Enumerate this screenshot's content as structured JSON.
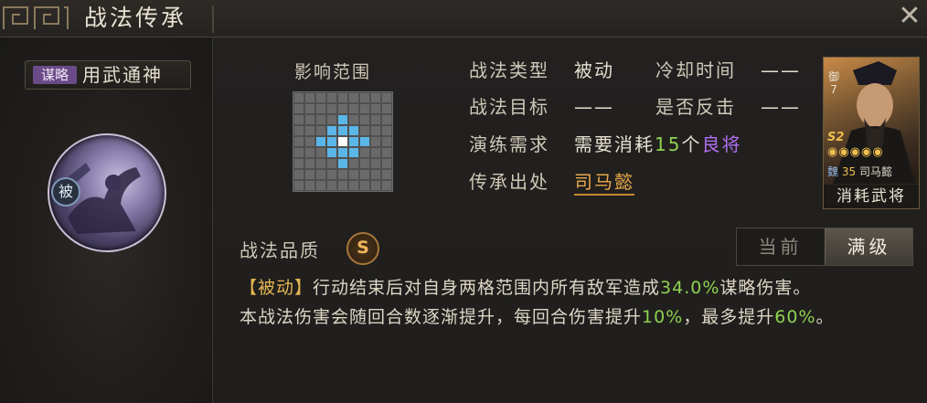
{
  "window": {
    "title": "战法传承"
  },
  "skill": {
    "type_badge": "谋略",
    "name": "用武通神",
    "passive_badge": "被",
    "quality_label": "战法品质",
    "quality": "S"
  },
  "range": {
    "label": "影响范围",
    "grid_size": 9,
    "center": [
      4,
      4
    ],
    "highlighted": [
      [
        2,
        4
      ],
      [
        3,
        3
      ],
      [
        3,
        4
      ],
      [
        3,
        5
      ],
      [
        4,
        2
      ],
      [
        4,
        3
      ],
      [
        4,
        5
      ],
      [
        4,
        6
      ],
      [
        5,
        3
      ],
      [
        5,
        4
      ],
      [
        5,
        5
      ],
      [
        6,
        4
      ]
    ],
    "cell_color": "#6a6a6a",
    "highlight_color": "#5bb6e8",
    "center_color": "#ffffff"
  },
  "attributes": {
    "type_label": "战法类型",
    "type_value": "被动",
    "cooldown_label": "冷却时间",
    "cooldown_value": "——",
    "target_label": "战法目标",
    "target_value": "——",
    "counter_label": "是否反击",
    "counter_value": "——",
    "drill_label": "演练需求",
    "drill_prefix": "需要消耗",
    "drill_count": "15",
    "drill_unit": "个",
    "drill_item": "良将",
    "origin_label": "传承出处",
    "origin_value": "司马懿"
  },
  "card": {
    "caption": "消耗武将",
    "faction": "魏",
    "level": "35",
    "name": "司马懿",
    "season": "S2",
    "army": "御",
    "cost": "7"
  },
  "toggle": {
    "current": "当前",
    "max": "满级"
  },
  "description": {
    "tag": "【被动】",
    "line1_a": "行动结束后对自身两格范围内所有敌军造成",
    "line1_num": "34.0%",
    "line1_b": "谋略伤害。",
    "line2_a": "本战法伤害会随回合数逐渐提升，每回合伤害提升",
    "line2_num1": "10%",
    "line2_b": "，最多提升",
    "line2_num2": "60%",
    "line2_c": "。"
  },
  "colors": {
    "green": "#8fd14f",
    "purple": "#b06ef0",
    "gold": "#e8a84a",
    "badge_purple": "#6a4b87"
  }
}
